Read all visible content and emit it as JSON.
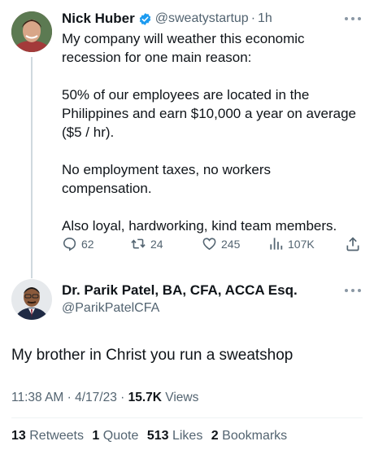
{
  "tweet1": {
    "author_name": "Nick Huber",
    "handle": "@sweatystartup",
    "separator": "·",
    "time": "1h",
    "paragraphs": [
      "My company will weather this economic recession for one main reason:",
      "50% of our employees are located in the Philippines and earn $10,000 a year on average ($5 / hr).",
      "No employment taxes, no workers compensation.",
      "Also loyal, hardworking, kind team members."
    ],
    "actions": {
      "replies": "62",
      "retweets": "24",
      "likes": "245",
      "views": "107K"
    }
  },
  "tweet2": {
    "author_name": "Dr. Parik Patel, BA, CFA, ACCA Esq.",
    "handle": "@ParikPatelCFA",
    "text": "My brother in Christ you run a sweatshop",
    "timestamp": "11:38 AM · 4/17/23 · ",
    "views_count": "15.7K",
    "views_label": " Views",
    "stats": {
      "retweets_count": "13",
      "retweets_label": "Retweets",
      "quotes_count": "1",
      "quotes_label": "Quote",
      "likes_count": "513",
      "likes_label": "Likes",
      "bookmarks_count": "2",
      "bookmarks_label": "Bookmarks"
    }
  },
  "colors": {
    "primary_text": "#0f1419",
    "secondary_text": "#536471",
    "verified_blue": "#1d9bf0",
    "thread_line": "#cfd9de"
  },
  "icons": {
    "verified": "verified-badge-icon",
    "reply": "reply-icon",
    "retweet": "retweet-icon",
    "like": "heart-icon",
    "views": "analytics-icon",
    "share": "share-icon",
    "more": "more-options-icon"
  }
}
